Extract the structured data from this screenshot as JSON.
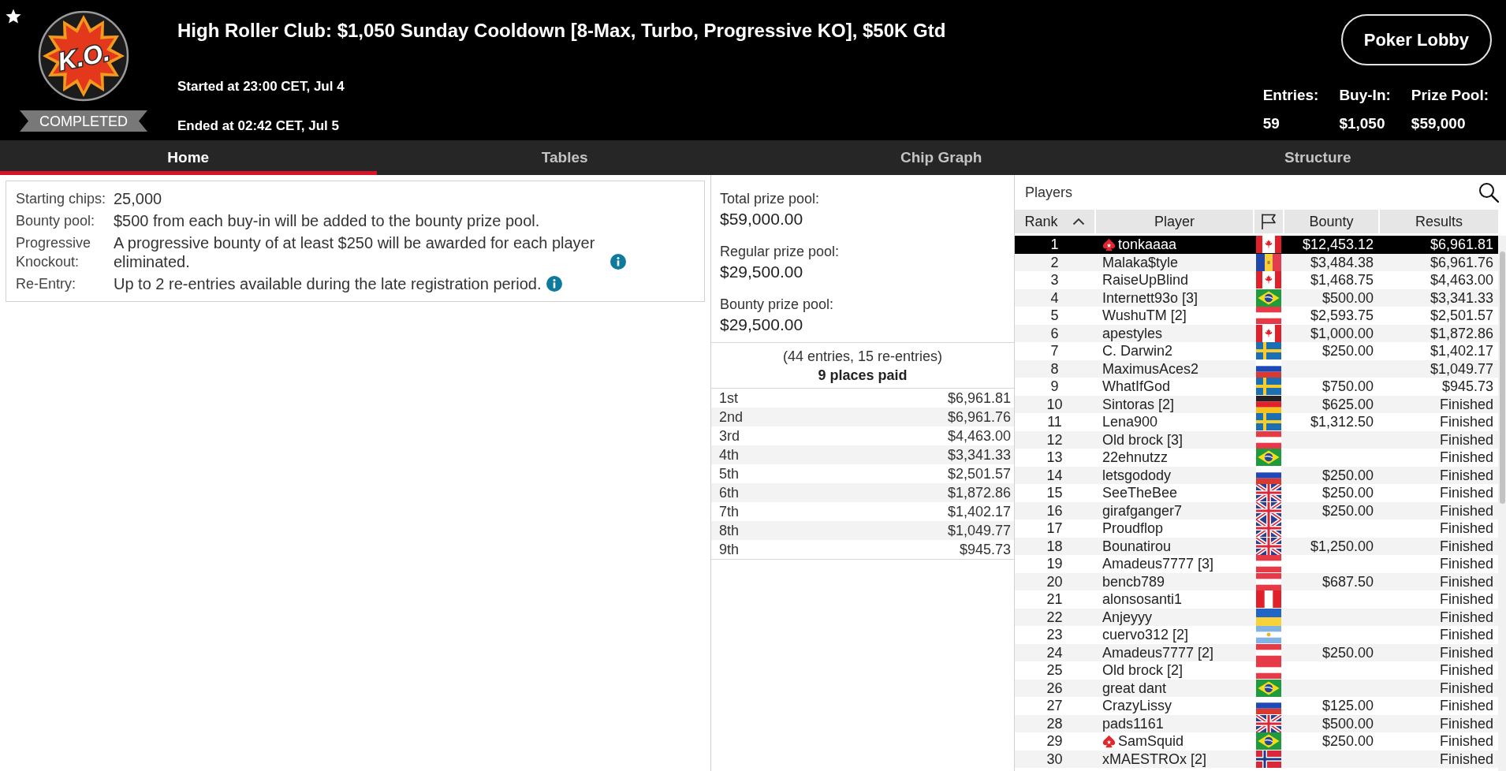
{
  "header": {
    "logo_text": "K.O.",
    "status": "COMPLETED",
    "title": "High Roller Club: $1,050 Sunday Cooldown [8-Max, Turbo, Progressive KO], $50K Gtd",
    "started": "Started at 23:00 CET, Jul 4",
    "ended": "Ended at 02:42 CET, Jul 5",
    "lobby_button": "Poker Lobby",
    "stats": [
      {
        "label": "Entries:",
        "value": "59"
      },
      {
        "label": "Buy-In:",
        "value": "$1,050"
      },
      {
        "label": "Prize Pool:",
        "value": "$59,000"
      }
    ]
  },
  "tabs": [
    {
      "label": "Home",
      "selected": true
    },
    {
      "label": "Tables",
      "selected": false
    },
    {
      "label": "Chip Graph",
      "selected": false
    },
    {
      "label": "Structure",
      "selected": false
    }
  ],
  "details": [
    {
      "label": "Starting chips:",
      "value": "25,000",
      "info": false
    },
    {
      "label": "Bounty pool:",
      "value": "$500 from each buy-in will be added to the bounty prize pool.",
      "info": false
    },
    {
      "label": "Progressive Knockout:",
      "value": "A progressive bounty of at least $250 will be awarded for each player eliminated.",
      "info": true
    },
    {
      "label": "Re-Entry:",
      "value": "Up to 2 re-entries available during the late registration period.",
      "info": true
    }
  ],
  "prize_pools": [
    {
      "label": "Total prize pool:",
      "value": "$59,000.00"
    },
    {
      "label": "Regular prize pool:",
      "value": "$29,500.00"
    },
    {
      "label": "Bounty prize pool:",
      "value": "$29,500.00"
    }
  ],
  "entries_summary": "(44 entries, 15 re-entries)",
  "places_paid": "9 places paid",
  "payouts": [
    {
      "place": "1st",
      "amount": "$6,961.81"
    },
    {
      "place": "2nd",
      "amount": "$6,961.76"
    },
    {
      "place": "3rd",
      "amount": "$4,463.00"
    },
    {
      "place": "4th",
      "amount": "$3,341.33"
    },
    {
      "place": "5th",
      "amount": "$2,501.57"
    },
    {
      "place": "6th",
      "amount": "$1,872.86"
    },
    {
      "place": "7th",
      "amount": "$1,402.17"
    },
    {
      "place": "8th",
      "amount": "$1,049.77"
    },
    {
      "place": "9th",
      "amount": "$945.73"
    }
  ],
  "players": {
    "title": "Players",
    "columns": [
      {
        "kind": "text",
        "label": "Rank",
        "sorted": true
      },
      {
        "kind": "text",
        "label": "Player",
        "sorted": false
      },
      {
        "kind": "flag",
        "sorted": false
      },
      {
        "kind": "text",
        "label": "Bounty",
        "sorted": false
      },
      {
        "kind": "text",
        "label": "Results",
        "sorted": false
      }
    ],
    "rows": [
      {
        "rank": "1",
        "player": "tonkaaaa",
        "badge": true,
        "kind": "canada",
        "bounty": "$12,453.12",
        "result": "$6,961.81",
        "selected": true
      },
      {
        "rank": "2",
        "player": "Malaka$tyle",
        "badge": false,
        "kind": "moldova",
        "bounty": "$3,484.38",
        "result": "$6,961.76",
        "selected": false
      },
      {
        "rank": "3",
        "player": "RaiseUpBlind",
        "badge": false,
        "kind": "canada",
        "bounty": "$1,468.75",
        "result": "$4,463.00",
        "selected": false
      },
      {
        "rank": "4",
        "player": "Internett93o [3]",
        "badge": false,
        "kind": "brazil",
        "bounty": "$500.00",
        "result": "$3,341.33",
        "selected": false
      },
      {
        "rank": "5",
        "player": "WushuTM [2]",
        "badge": false,
        "kind": "austria",
        "bounty": "$2,593.75",
        "result": "$2,501.57",
        "selected": false
      },
      {
        "rank": "6",
        "player": "apestyles",
        "badge": false,
        "kind": "canada",
        "bounty": "$1,000.00",
        "result": "$1,872.86",
        "selected": false
      },
      {
        "rank": "7",
        "player": "C. Darwin2",
        "badge": false,
        "kind": "sweden",
        "bounty": "$250.00",
        "result": "$1,402.17",
        "selected": false
      },
      {
        "rank": "8",
        "player": "MaximusAces2",
        "badge": false,
        "kind": "russia",
        "result": "$1,049.77",
        "selected": false
      },
      {
        "rank": "9",
        "player": "WhatIfGod",
        "badge": false,
        "kind": "sweden",
        "bounty": "$750.00",
        "result": "$945.73",
        "selected": false
      },
      {
        "rank": "10",
        "player": "Sintoras [2]",
        "badge": false,
        "kind": "germany",
        "bounty": "$625.00",
        "result": "Finished",
        "selected": false
      },
      {
        "rank": "11",
        "player": "Lena900",
        "badge": false,
        "kind": "sweden",
        "bounty": "$1,312.50",
        "result": "Finished",
        "selected": false
      },
      {
        "rank": "12",
        "player": "Old brock [3]",
        "badge": false,
        "kind": "austria",
        "result": "Finished",
        "selected": false
      },
      {
        "rank": "13",
        "player": "22ehnutzz",
        "badge": false,
        "kind": "brazil",
        "result": "Finished",
        "selected": false
      },
      {
        "rank": "14",
        "player": "letsgodody",
        "badge": false,
        "kind": "russia",
        "bounty": "$250.00",
        "result": "Finished",
        "selected": false
      },
      {
        "rank": "15",
        "player": "SeeTheBee",
        "badge": false,
        "kind": "uk",
        "bounty": "$250.00",
        "result": "Finished",
        "selected": false
      },
      {
        "rank": "16",
        "player": "girafganger7",
        "badge": false,
        "kind": "uk",
        "bounty": "$250.00",
        "result": "Finished",
        "selected": false
      },
      {
        "rank": "17",
        "player": "Proudflop",
        "badge": false,
        "kind": "uk",
        "result": "Finished",
        "selected": false
      },
      {
        "rank": "18",
        "player": "Bounatirou",
        "badge": false,
        "kind": "uk",
        "bounty": "$1,250.00",
        "result": "Finished",
        "selected": false
      },
      {
        "rank": "19",
        "player": "Amadeus7777 [3]",
        "badge": false,
        "kind": "austria",
        "result": "Finished",
        "selected": false
      },
      {
        "rank": "20",
        "player": "bencb789",
        "badge": false,
        "kind": "austria",
        "bounty": "$687.50",
        "result": "Finished",
        "selected": false
      },
      {
        "rank": "21",
        "player": "alonsosanti1",
        "badge": false,
        "kind": "peru",
        "result": "Finished",
        "selected": false
      },
      {
        "rank": "22",
        "player": "Anjeyyy",
        "badge": false,
        "kind": "ukraine",
        "result": "Finished",
        "selected": false
      },
      {
        "rank": "23",
        "player": "cuervo312 [2]",
        "badge": false,
        "kind": "argentina",
        "result": "Finished",
        "selected": false
      },
      {
        "rank": "24",
        "player": "Amadeus7777 [2]",
        "badge": false,
        "kind": "austria",
        "bounty": "$250.00",
        "result": "Finished",
        "selected": false
      },
      {
        "rank": "25",
        "player": "Old brock [2]",
        "badge": false,
        "kind": "austria",
        "result": "Finished",
        "selected": false
      },
      {
        "rank": "26",
        "player": "great dant",
        "badge": false,
        "kind": "brazil",
        "result": "Finished",
        "selected": false
      },
      {
        "rank": "27",
        "player": "CrazyLissy",
        "badge": false,
        "kind": "russia",
        "bounty": "$125.00",
        "result": "Finished",
        "selected": false
      },
      {
        "rank": "28",
        "player": "pads1161",
        "badge": false,
        "kind": "uk",
        "bounty": "$500.00",
        "result": "Finished",
        "selected": false
      },
      {
        "rank": "29",
        "player": "SamSquid",
        "badge": true,
        "kind": "brazil",
        "bounty": "$250.00",
        "result": "Finished",
        "selected": false
      },
      {
        "rank": "30",
        "player": "xMAESTROx [2]",
        "badge": false,
        "kind": "norway",
        "result": "Finished",
        "selected": false
      }
    ]
  }
}
